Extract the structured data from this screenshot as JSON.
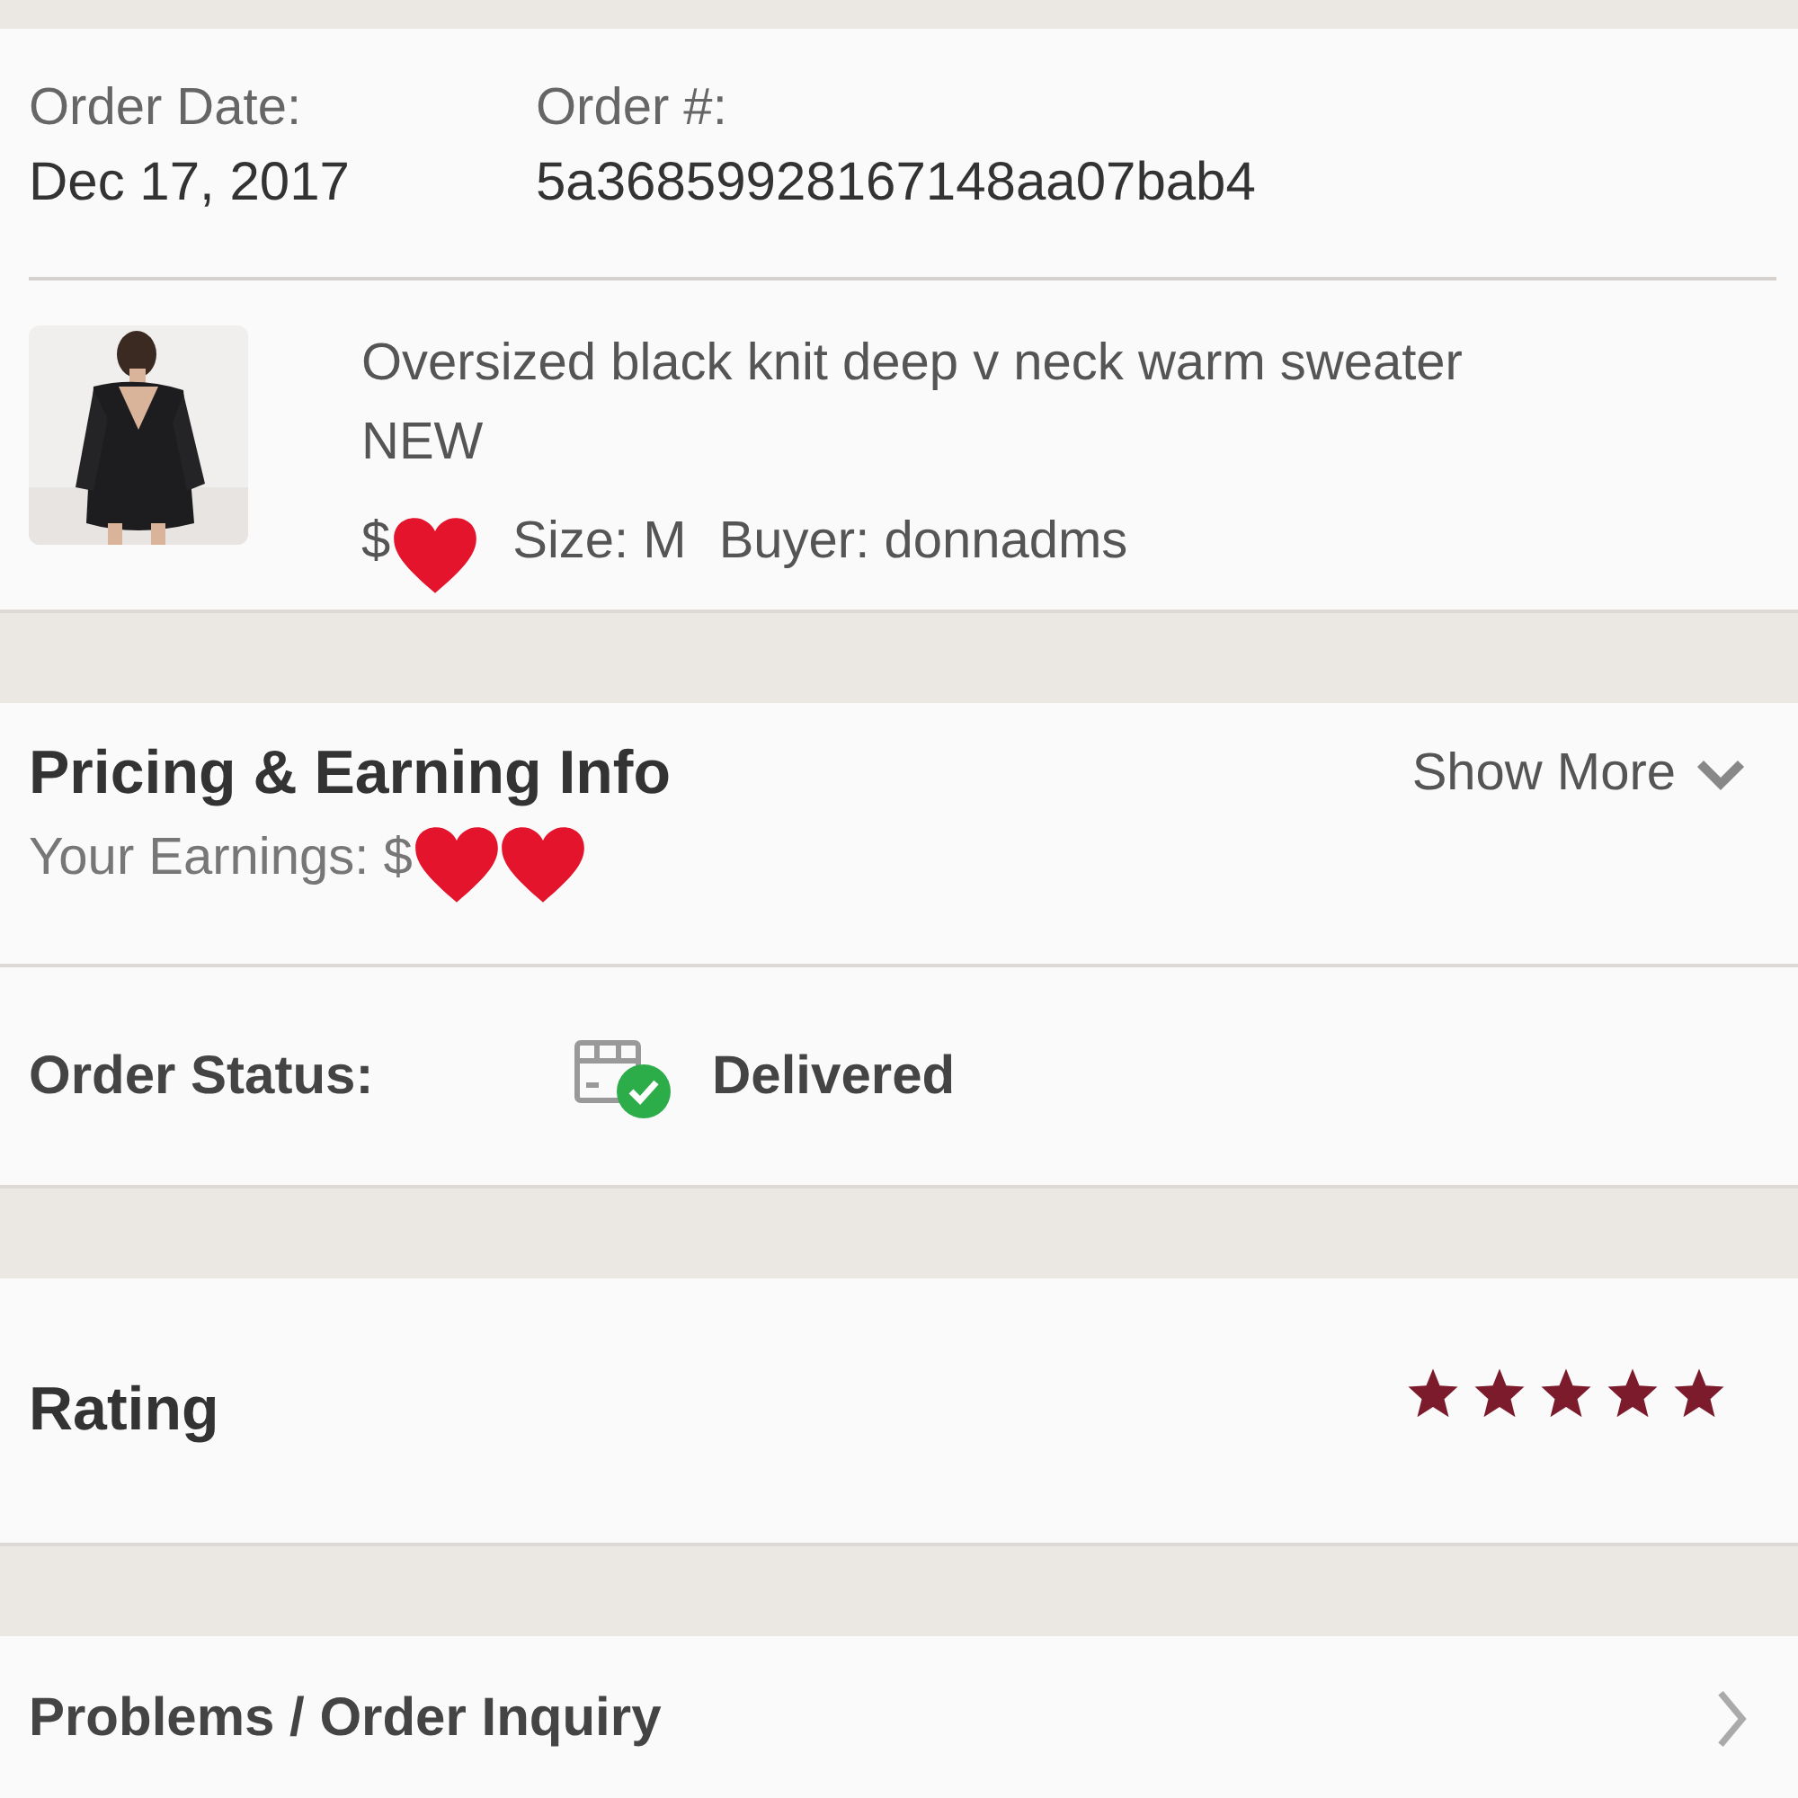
{
  "order": {
    "date_label": "Order Date:",
    "date": "Dec 17, 2017",
    "number_label": "Order #:",
    "number": "5a36859928167148aa07bab4"
  },
  "item": {
    "title": "Oversized black knit deep v neck warm sweater NEW",
    "price_prefix": "$",
    "size": "Size: M",
    "buyer": "Buyer: donnadms"
  },
  "pricing": {
    "title": "Pricing & Earning Info",
    "toggle": "Show More",
    "expanded": false,
    "earnings": "Your Earnings: $"
  },
  "status": {
    "label": "Order Status:",
    "value": "Delivered"
  },
  "rating": {
    "label": "Rating",
    "stars": 5
  },
  "inquiry": {
    "label": "Problems / Order Inquiry"
  }
}
